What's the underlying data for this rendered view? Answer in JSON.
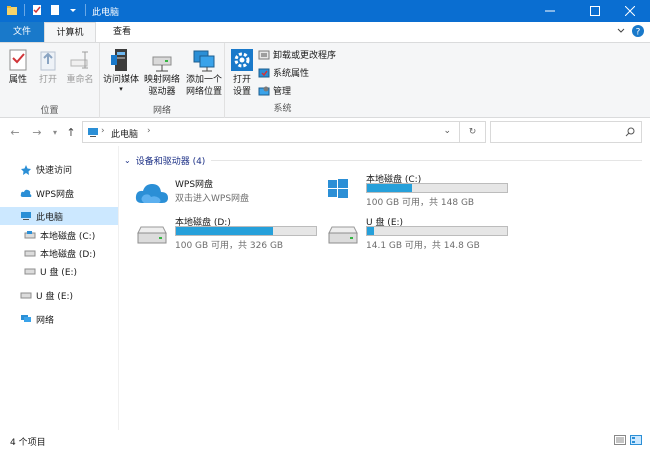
{
  "window": {
    "title": "此电脑",
    "minimize_icon": "minimize-icon",
    "maximize_icon": "maximize-icon",
    "close_icon": "close-icon"
  },
  "ribbon_tabs": [
    {
      "label": "文件"
    },
    {
      "label": "计算机"
    },
    {
      "label": "查看"
    }
  ],
  "ribbon": {
    "location_group": {
      "label": "位置",
      "buttons": [
        {
          "label": "属性",
          "icon": "checklist-icon"
        },
        {
          "label": "打开",
          "icon": "open-icon"
        },
        {
          "label": "重命名",
          "icon": "rename-icon"
        }
      ]
    },
    "network_group": {
      "label": "网络",
      "buttons": [
        {
          "label": "访问媒体",
          "icon": "media-server-icon"
        },
        {
          "label": "映射网络\n驱动器",
          "icon": "map-drive-icon"
        },
        {
          "label": "添加一个\n网络位置",
          "icon": "network-location-icon"
        }
      ]
    },
    "system_group": {
      "label": "系统",
      "open_settings": {
        "label": "打开\n设置",
        "icon": "settings-icon"
      },
      "small_buttons": [
        {
          "label": "卸载或更改程序",
          "icon": "uninstall-icon"
        },
        {
          "label": "系统属性",
          "icon": "system-properties-icon"
        },
        {
          "label": "管理",
          "icon": "manage-icon"
        }
      ]
    }
  },
  "address": {
    "path": "此电脑",
    "search_placeholder": ""
  },
  "sidebar": {
    "items": [
      {
        "label": "快速访问",
        "icon": "star-icon"
      },
      {
        "label": "WPS网盘",
        "icon": "cloud-icon"
      },
      {
        "label": "此电脑",
        "icon": "computer-icon"
      },
      {
        "label": "本地磁盘 (C:)",
        "icon": "drive-icon"
      },
      {
        "label": "本地磁盘 (D:)",
        "icon": "drive-icon"
      },
      {
        "label": "U 盘 (E:)",
        "icon": "usb-drive-icon"
      },
      {
        "label": "U 盘 (E:)",
        "icon": "usb-drive-icon"
      },
      {
        "label": "网络",
        "icon": "network-icon"
      }
    ]
  },
  "content": {
    "group_title": "设备和驱动器 (4)",
    "tiles": [
      {
        "name": "WPS网盘",
        "sub": "双击进入WPS网盘",
        "icon": "cloud-icon"
      },
      {
        "name": "本地磁盘 (C:)",
        "sub": "100 GB 可用，共 148 GB",
        "used_fraction": 0.32,
        "icon": "windows-drive-icon"
      },
      {
        "name": "本地磁盘 (D:)",
        "sub": "100 GB 可用，共 326 GB",
        "used_fraction": 0.69,
        "icon": "drive-icon"
      },
      {
        "name": "U 盘 (E:)",
        "sub": "14.1 GB 可用，共 14.8 GB",
        "used_fraction": 0.05,
        "icon": "usb-drive-icon"
      }
    ]
  },
  "status": {
    "items_count": "4 个项目"
  },
  "colors": {
    "accent": "#0a6ed1",
    "bar_fill": "#26a0da",
    "selected": "#cce8ff"
  }
}
